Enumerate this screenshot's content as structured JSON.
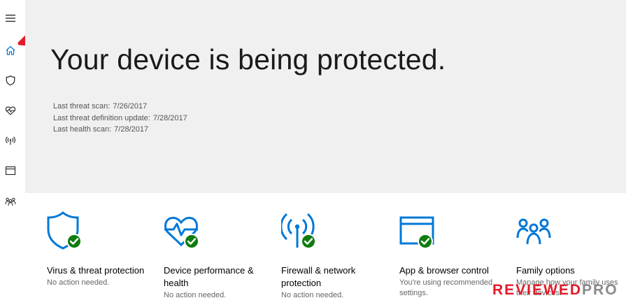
{
  "colors": {
    "accent": "#0078d7",
    "check": "#107c10",
    "hero_bg": "#f0f0f0",
    "annotation": "#e21b2a"
  },
  "sidebar": {
    "items": [
      {
        "icon": "hamburger-menu-icon"
      },
      {
        "icon": "home-icon"
      },
      {
        "icon": "shield-icon"
      },
      {
        "icon": "heart-pulse-icon"
      },
      {
        "icon": "antenna-icon"
      },
      {
        "icon": "browser-window-icon"
      },
      {
        "icon": "family-icon"
      }
    ]
  },
  "hero": {
    "title": "Your device is being protected.",
    "scans": [
      {
        "label": "Last threat scan:",
        "value": "7/26/2017"
      },
      {
        "label": "Last threat definition update:",
        "value": "7/28/2017"
      },
      {
        "label": "Last health scan:",
        "value": "7/28/2017"
      }
    ]
  },
  "tiles": [
    {
      "icon": "shield-icon",
      "title": "Virus & threat protection",
      "status": "No action needed."
    },
    {
      "icon": "heart-pulse-icon",
      "title": "Device performance & health",
      "status": "No action needed."
    },
    {
      "icon": "antenna-icon",
      "title": "Firewall & network protection",
      "status": "No action needed."
    },
    {
      "icon": "browser-window-icon",
      "title": "App & browser control",
      "status": "You're using recommended settings."
    },
    {
      "icon": "family-icon",
      "title": "Family options",
      "status": "Manage how your family uses their devices."
    }
  ],
  "watermark": {
    "part1": "REVIEWED",
    "part2": "PRO"
  }
}
